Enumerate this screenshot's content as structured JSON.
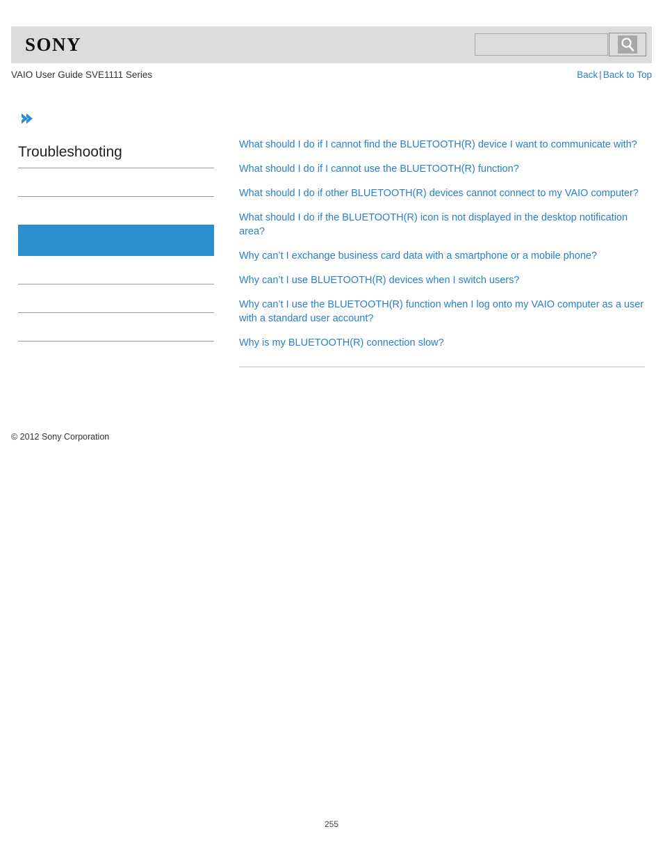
{
  "header": {
    "brand": "SONY",
    "search": {
      "value": "",
      "placeholder": "",
      "button_icon": "search-icon"
    }
  },
  "subheader": {
    "guide_title": "VAIO User Guide SVE1111 Series",
    "back_label": "Back",
    "separator": "|",
    "back_to_top_label": "Back to Top"
  },
  "sidebar": {
    "breadcrumb_icon": "chevron-right-icon",
    "title": "Troubleshooting",
    "accent_color": "#2b8ecd",
    "items": [
      {
        "label": "",
        "selected": false,
        "divider_below": true
      },
      {
        "label": "",
        "selected": false,
        "divider_below": false
      },
      {
        "label": "",
        "selected": true,
        "divider_below": false
      },
      {
        "label": "",
        "selected": false,
        "divider_below": true
      },
      {
        "label": "",
        "selected": false,
        "divider_below": true
      },
      {
        "label": "",
        "selected": false,
        "divider_below": true
      }
    ]
  },
  "content": {
    "links": [
      "What should I do if I cannot find the BLUETOOTH(R) device I want to communicate with?",
      "What should I do if I cannot use the BLUETOOTH(R) function?",
      "What should I do if other BLUETOOTH(R) devices cannot connect to my VAIO computer?",
      "What should I do if the BLUETOOTH(R) icon is not displayed in the desktop notification area?",
      "Why can’t I exchange business card data with a smartphone or a mobile phone?",
      "Why can’t I use BLUETOOTH(R) devices when I switch users?",
      "Why can’t I use the BLUETOOTH(R) function when I log onto my VAIO computer as a user with a standard user account?",
      "Why is my BLUETOOTH(R) connection slow?"
    ],
    "link_color": "#2a7fc9"
  },
  "footer": {
    "copyright": "© 2012 Sony Corporation",
    "page_number": "255"
  }
}
